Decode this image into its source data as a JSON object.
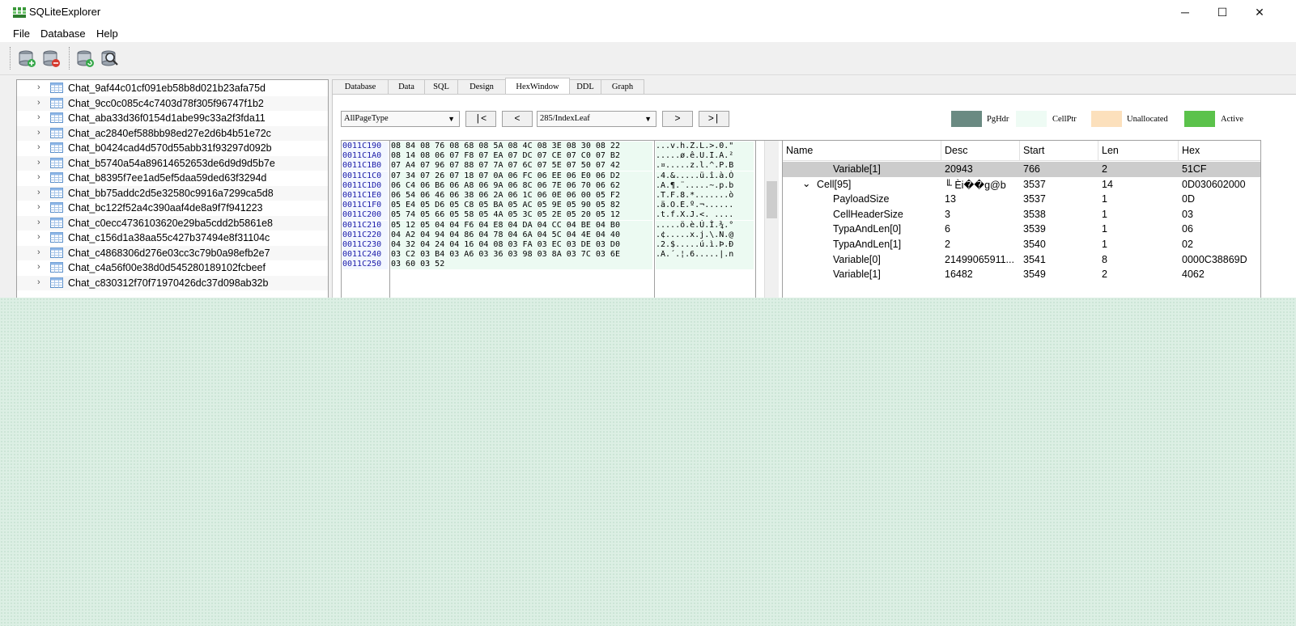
{
  "window": {
    "title": "SQLiteExplorer",
    "minimize": "─",
    "maximize": "☐",
    "close": "✕"
  },
  "menu": [
    {
      "label": "File"
    },
    {
      "label": "Database"
    },
    {
      "label": "Help"
    }
  ],
  "toolbar": [
    {
      "icon": "open-database-icon"
    },
    {
      "icon": "close-database-icon"
    },
    {
      "icon": "refresh-database-icon"
    },
    {
      "icon": "search-database-icon"
    }
  ],
  "tree": {
    "arrow": "›",
    "items": [
      "Chat_9af44c01cf091eb58b8d021b23afa75d",
      "Chat_9cc0c085c4c7403d78f305f96747f1b2",
      "Chat_aba33d36f0154d1abe99c33a2f3fda11",
      "Chat_ac2840ef588bb98ed27e2d6b4b51e72c",
      "Chat_b0424cad4d570d55abb31f93297d092b",
      "Chat_b5740a54a89614652653de6d9d9d5b7e",
      "Chat_b8395f7ee1ad5ef5daa59ded63f3294d",
      "Chat_bb75addc2d5e32580c9916a7299ca5d8",
      "Chat_bc122f52a4c390aaf4de8a9f7f941223",
      "Chat_c0ecc4736103620e29ba5cdd2b5861e8",
      "Chat_c156d1a38aa55c427b37494e8f31104c",
      "Chat_c4868306d276e03cc3c79b0a98efb2e7",
      "Chat_c4a56f00e38d0d545280189102fcbeef",
      "Chat_c830312f70f71970426dc37d098ab32b"
    ]
  },
  "tabs": [
    "Database",
    "Data",
    "SQL",
    "Design",
    "HexWindow",
    "DDL",
    "Graph"
  ],
  "active_tab": "HexWindow",
  "hexwindow": {
    "page_type": "AllPageType",
    "page": "285/IndexLeaf",
    "first": "|<",
    "prev": "<",
    "next": ">",
    "last": ">|",
    "dropdown": "▼",
    "legend": [
      {
        "label": "PgHdr",
        "color": "#6a8a82"
      },
      {
        "label": "CellPtr",
        "color": "#eefbf4"
      },
      {
        "label": "Unallocated",
        "color": "#fce0bc"
      },
      {
        "label": "Active",
        "color": "#5bc24b"
      }
    ],
    "rows": [
      {
        "addr": "0011C190",
        "bytes": "08 84 08 76 08 68 08 5A 08 4C 08 3E 08 30 08 22",
        "ascii": "...v.h.Z.L.>.0.\""
      },
      {
        "addr": "0011C1A0",
        "bytes": "08 14 08 06 07 F8 07 EA 07 DC 07 CE 07 C0 07 B2",
        "ascii": ".....ø.ê.Ü.Î.À.²"
      },
      {
        "addr": "0011C1B0",
        "bytes": "07 A4 07 96 07 88 07 7A 07 6C 07 5E 07 50 07 42",
        "ascii": ".¤.....z.l.^.P.B"
      },
      {
        "addr": "0011C1C0",
        "bytes": "07 34 07 26 07 18 07 0A 06 FC 06 EE 06 E0 06 D2",
        "ascii": ".4.&.....ü.î.à.Ò"
      },
      {
        "addr": "0011C1D0",
        "bytes": "06 C4 06 B6 06 A8 06 9A 06 8C 06 7E 06 70 06 62",
        "ascii": ".Ä.¶.¨.....~.p.b"
      },
      {
        "addr": "0011C1E0",
        "bytes": "06 54 06 46 06 38 06 2A 06 1C 06 0E 06 00 05 F2",
        "ascii": ".T.F.8.*.......ò"
      },
      {
        "addr": "0011C1F0",
        "bytes": "05 E4 05 D6 05 C8 05 BA 05 AC 05 9E 05 90 05 82",
        "ascii": ".ä.Ö.È.º.¬......"
      },
      {
        "addr": "0011C200",
        "bytes": "05 74 05 66 05 58 05 4A 05 3C 05 2E 05 20 05 12",
        "ascii": ".t.f.X.J.<. ...."
      },
      {
        "addr": "0011C210",
        "bytes": "05 12 05 04 04 F6 04 E8 04 DA 04 CC 04 BE 04 B0",
        "ascii": ".....ö.è.Ú.Ì.¾.°"
      },
      {
        "addr": "0011C220",
        "bytes": "04 A2 04 94 04 86 04 78 04 6A 04 5C 04 4E 04 40",
        "ascii": ".¢.....x.j.\\.N.@"
      },
      {
        "addr": "0011C230",
        "bytes": "04 32 04 24 04 16 04 08 03 FA 03 EC 03 DE 03 D0",
        "ascii": ".2.$.....ú.ì.Þ.Ð"
      },
      {
        "addr": "0011C240",
        "bytes": "03 C2 03 B4 03 A6 03 36 03 98 03 8A 03 7C 03 6E",
        "ascii": ".Â.´.¦.6.....|.n"
      },
      {
        "addr": "0011C250",
        "bytes": "03 60 03 52",
        "ascii": ""
      }
    ]
  },
  "details": {
    "columns": [
      "Name",
      "Desc",
      "Start",
      "Len",
      "Hex"
    ],
    "rows": [
      {
        "name": "Variable[1]",
        "desc": "20943",
        "start": "766",
        "len": "2",
        "hex": "51CF",
        "indent": 2,
        "selected": true
      },
      {
        "name": "Cell[95]",
        "desc": "╙ Èi��g@b",
        "start": "3537",
        "len": "14",
        "hex": "0D030602000",
        "indent": 1,
        "expander": "⌄"
      },
      {
        "name": "PayloadSize",
        "desc": "13",
        "start": "3537",
        "len": "1",
        "hex": "0D",
        "indent": 2
      },
      {
        "name": "CellHeaderSize",
        "desc": "3",
        "start": "3538",
        "len": "1",
        "hex": "03",
        "indent": 2
      },
      {
        "name": "TypaAndLen[0]",
        "desc": "6",
        "start": "3539",
        "len": "1",
        "hex": "06",
        "indent": 2
      },
      {
        "name": "TypaAndLen[1]",
        "desc": "2",
        "start": "3540",
        "len": "1",
        "hex": "02",
        "indent": 2
      },
      {
        "name": "Variable[0]",
        "desc": "21499065911...",
        "start": "3541",
        "len": "8",
        "hex": "0000C38869D",
        "indent": 2
      },
      {
        "name": "Variable[1]",
        "desc": "16482",
        "start": "3549",
        "len": "2",
        "hex": "4062",
        "indent": 2
      }
    ]
  }
}
